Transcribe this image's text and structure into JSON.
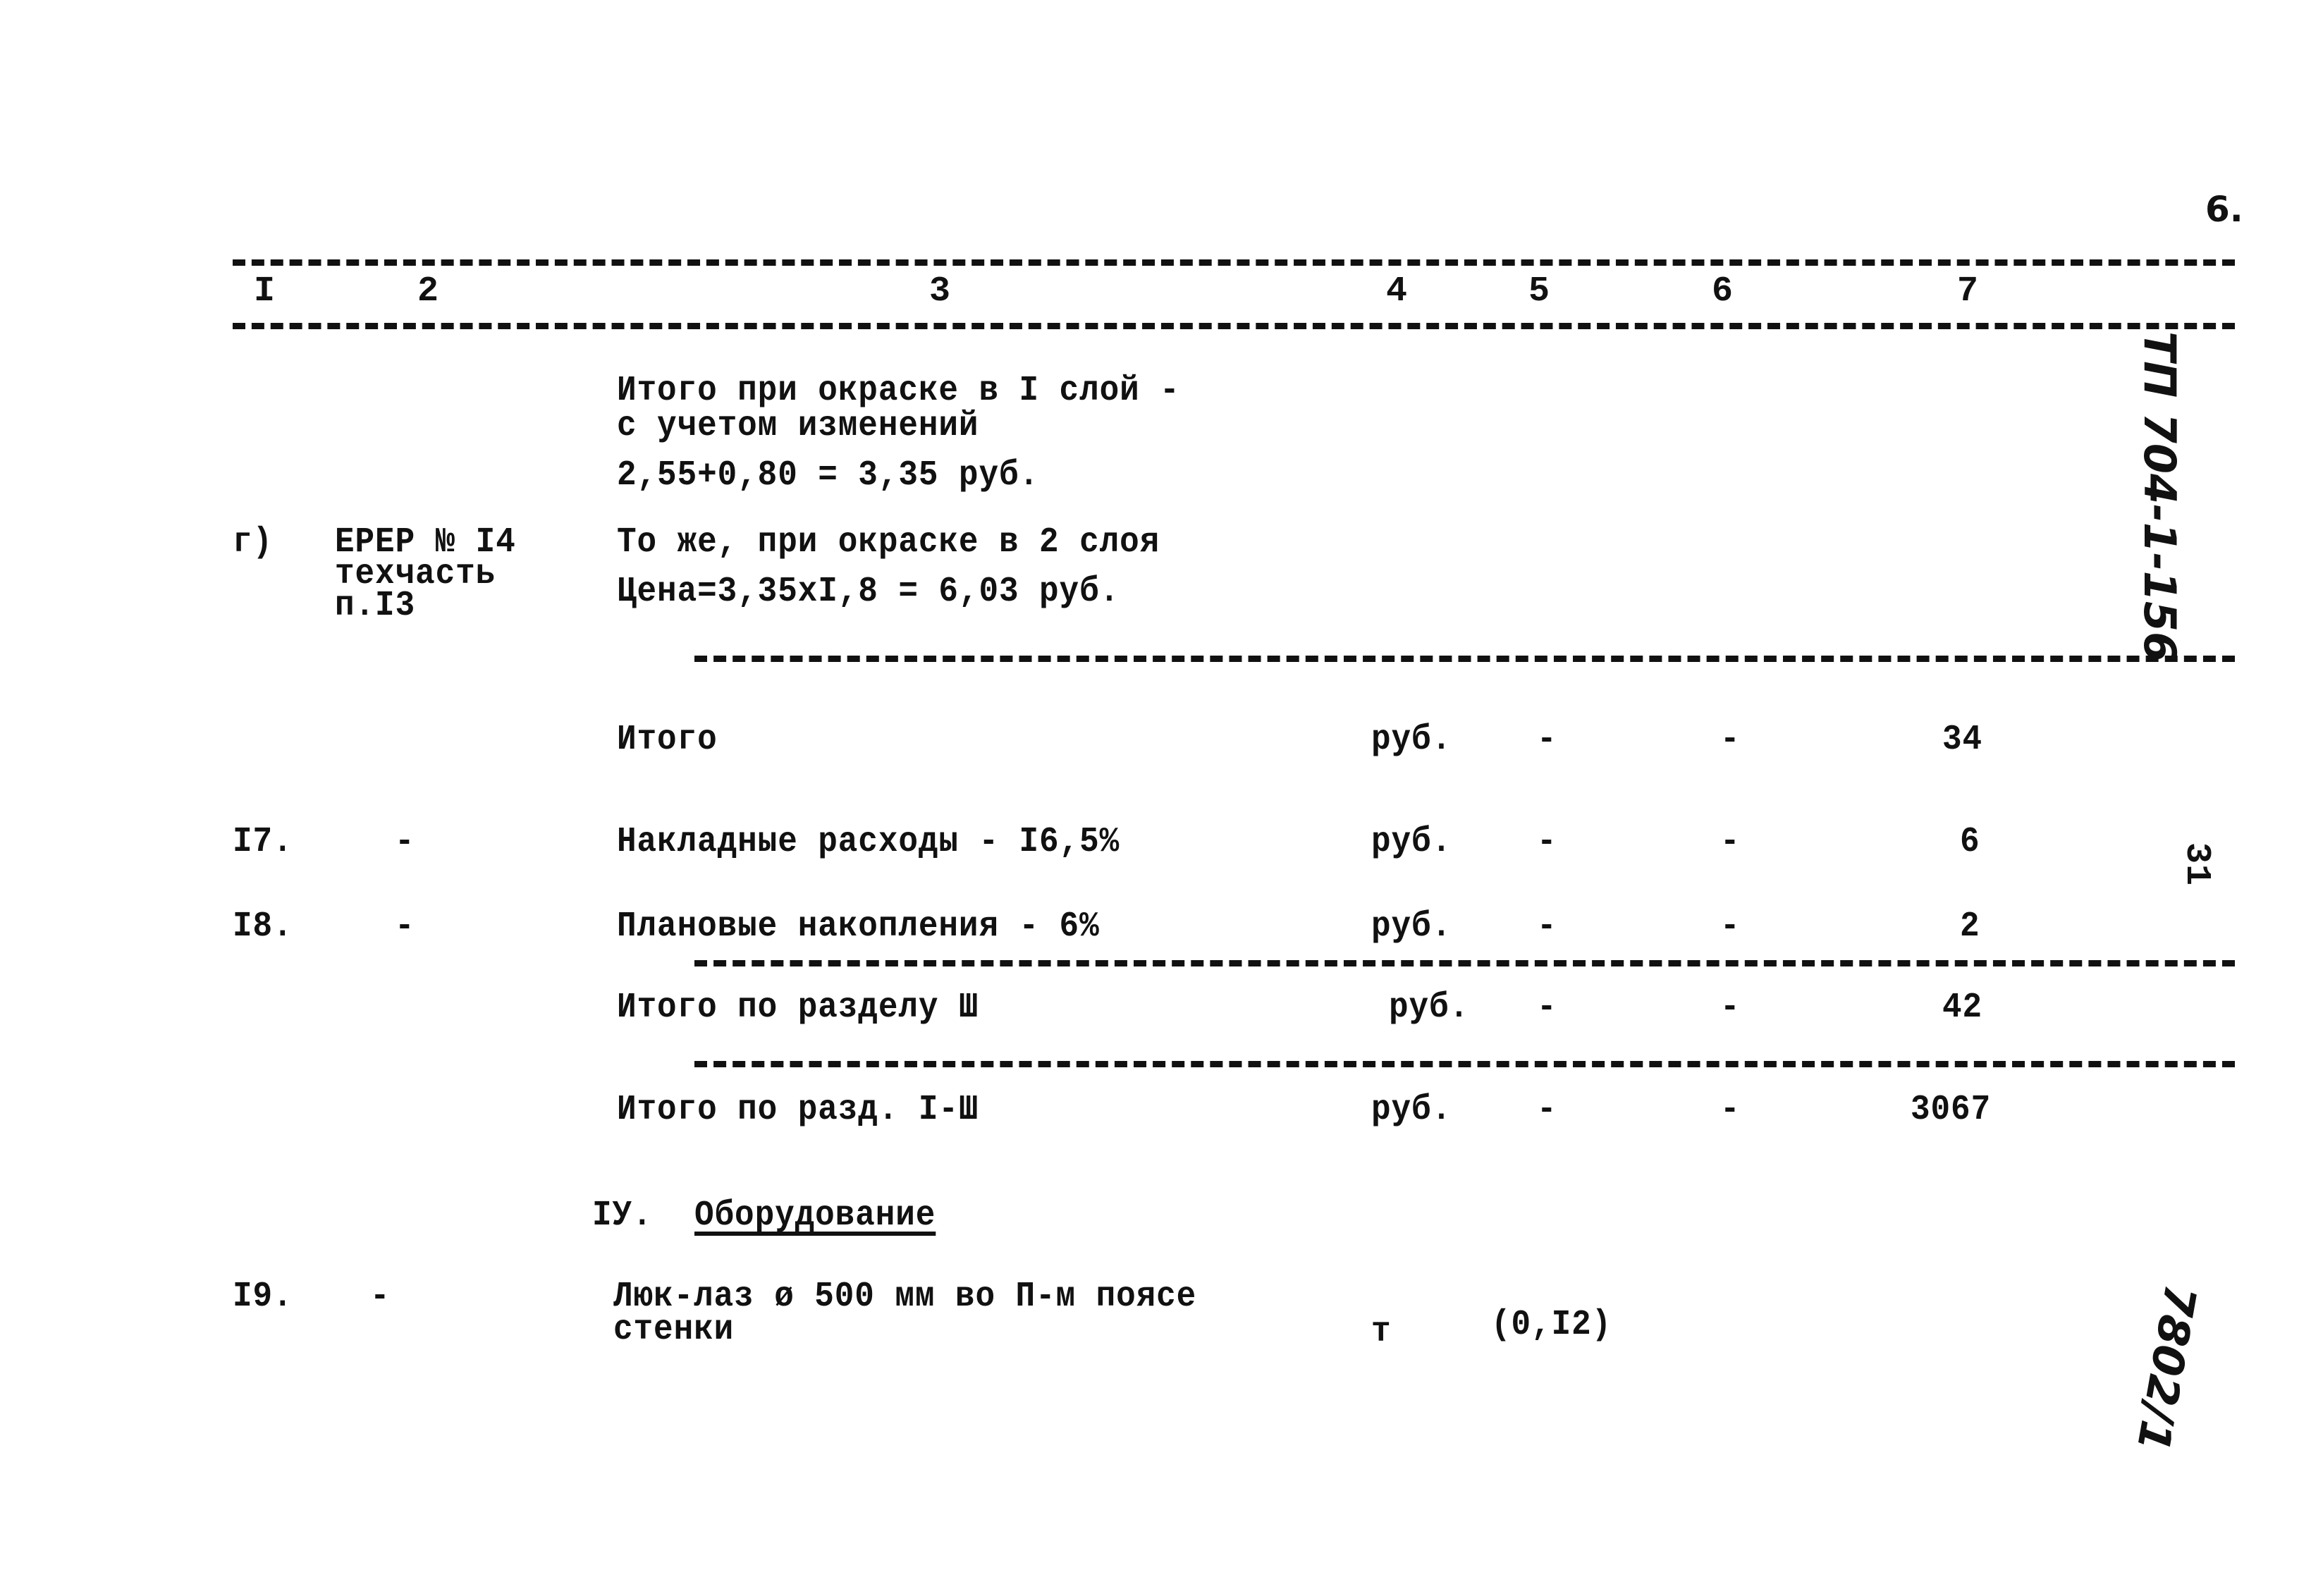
{
  "page_number": "6.",
  "margin_notes": {
    "top_right_vertical": "ТП 704-1-156",
    "mid_right_rotated": "31",
    "bottom_right_vertical": "7802/1"
  },
  "column_headers": [
    "I",
    "2",
    "3",
    "4",
    "5",
    "6",
    "7"
  ],
  "block_painting": {
    "line1": "Итого при окраске в I слой -",
    "line2": "с учетом изменений",
    "formula": "2,55+0,80 = 3,35 руб."
  },
  "row_g": {
    "col1": "г)",
    "col2_lines": [
      "ЕРЕР № I4",
      "техчасть",
      "п.I3"
    ],
    "col3_line1": "То же, при окраске в 2 слоя",
    "col3_line2": "Цена=3,35xI,8 = 6,03 руб."
  },
  "rows": [
    {
      "no": "",
      "ref": "",
      "name": "Итого",
      "unit": "руб.",
      "c5": "-",
      "c6": "-",
      "c7": "34"
    },
    {
      "no": "I7.",
      "ref": "-",
      "name": "Накладные расходы - I6,5%",
      "unit": "руб.",
      "c5": "-",
      "c6": "-",
      "c7": "6"
    },
    {
      "no": "I8.",
      "ref": "-",
      "name": "Плановые накопления - 6%",
      "unit": "руб.",
      "c5": "-",
      "c6": "-",
      "c7": "2"
    },
    {
      "no": "",
      "ref": "",
      "name": "Итого по разделу Ш",
      "unit": "руб.",
      "c5": "-",
      "c6": "-",
      "c7": "42"
    },
    {
      "no": "",
      "ref": "",
      "name": "Итого по разд. I-Ш",
      "unit": "руб.",
      "c5": "-",
      "c6": "-",
      "c7": "3067"
    }
  ],
  "section_iv": {
    "numeral": "IУ.",
    "title": "Оборудование"
  },
  "row_19": {
    "no": "I9.",
    "ref": "-",
    "name_line1": "Люк-лаз ø 500 мм во П-м поясе",
    "name_line2": "стенки",
    "unit": "т",
    "c5": "(0,I2)"
  }
}
